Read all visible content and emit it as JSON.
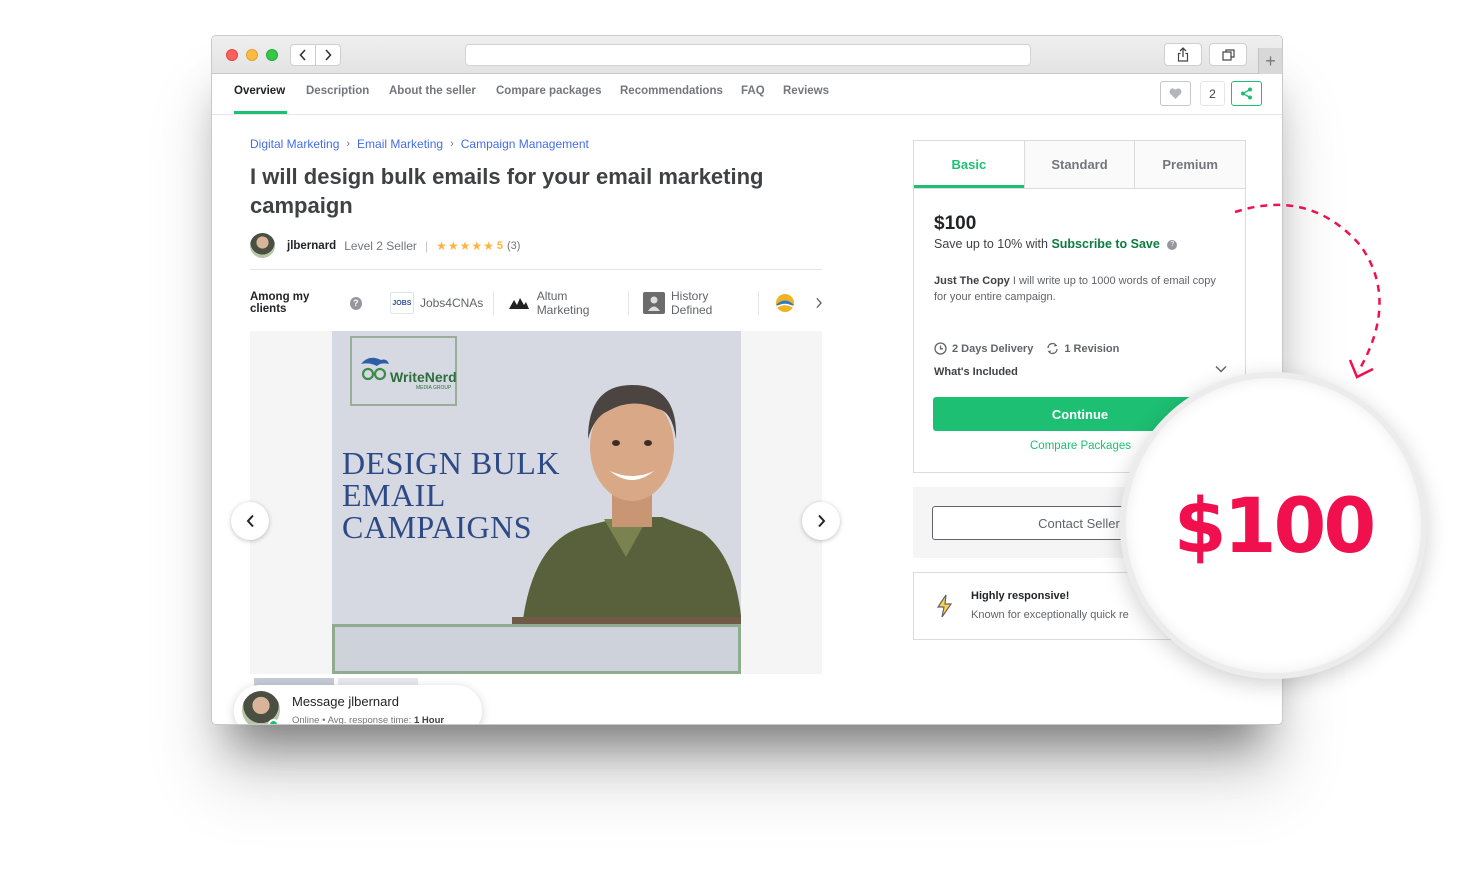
{
  "nav": {
    "tabs": [
      "Overview",
      "Description",
      "About the seller",
      "Compare packages",
      "Recommendations",
      "FAQ",
      "Reviews"
    ],
    "save_count": "2"
  },
  "breadcrumbs": [
    "Digital Marketing",
    "Email Marketing",
    "Campaign Management"
  ],
  "gig": {
    "title": "I will design bulk emails for your email marketing campaign",
    "seller_name": "jlbernard",
    "seller_level": "Level 2 Seller",
    "rating": "5",
    "review_count": "(3)"
  },
  "clients": {
    "label": "Among my clients",
    "items": [
      "Jobs4CNAs",
      "Altum Marketing",
      "History Defined"
    ]
  },
  "gallery": {
    "logo_text": "WriteNerd",
    "logo_sub": "MEDIA GROUP",
    "slide_line1": "DESIGN BULK",
    "slide_line2": "EMAIL",
    "slide_line3": "CAMPAIGNS"
  },
  "message": {
    "title": "Message jlbernard",
    "status": "Online",
    "response_label": "Avg. response time:",
    "response_value": "1 Hour"
  },
  "package": {
    "tabs": [
      "Basic",
      "Standard",
      "Premium"
    ],
    "price": "$100",
    "save_prefix": "Save up to 10% with",
    "save_link": "Subscribe to Save",
    "desc_title": "Just The Copy",
    "desc_body": "I will write up to 1000 words of email copy for your entire campaign.",
    "delivery": "2 Days Delivery",
    "revision": "1 Revision",
    "included": "What's Included",
    "continue": "Continue",
    "compare": "Compare Packages"
  },
  "contact": {
    "label": "Contact Seller"
  },
  "responsive": {
    "title": "Highly responsive!",
    "body": "Known for exceptionally quick re"
  },
  "callout": {
    "price": "$100"
  },
  "colors": {
    "accent": "#1dbf73",
    "callout": "#f0104d",
    "link": "#446ee7"
  }
}
